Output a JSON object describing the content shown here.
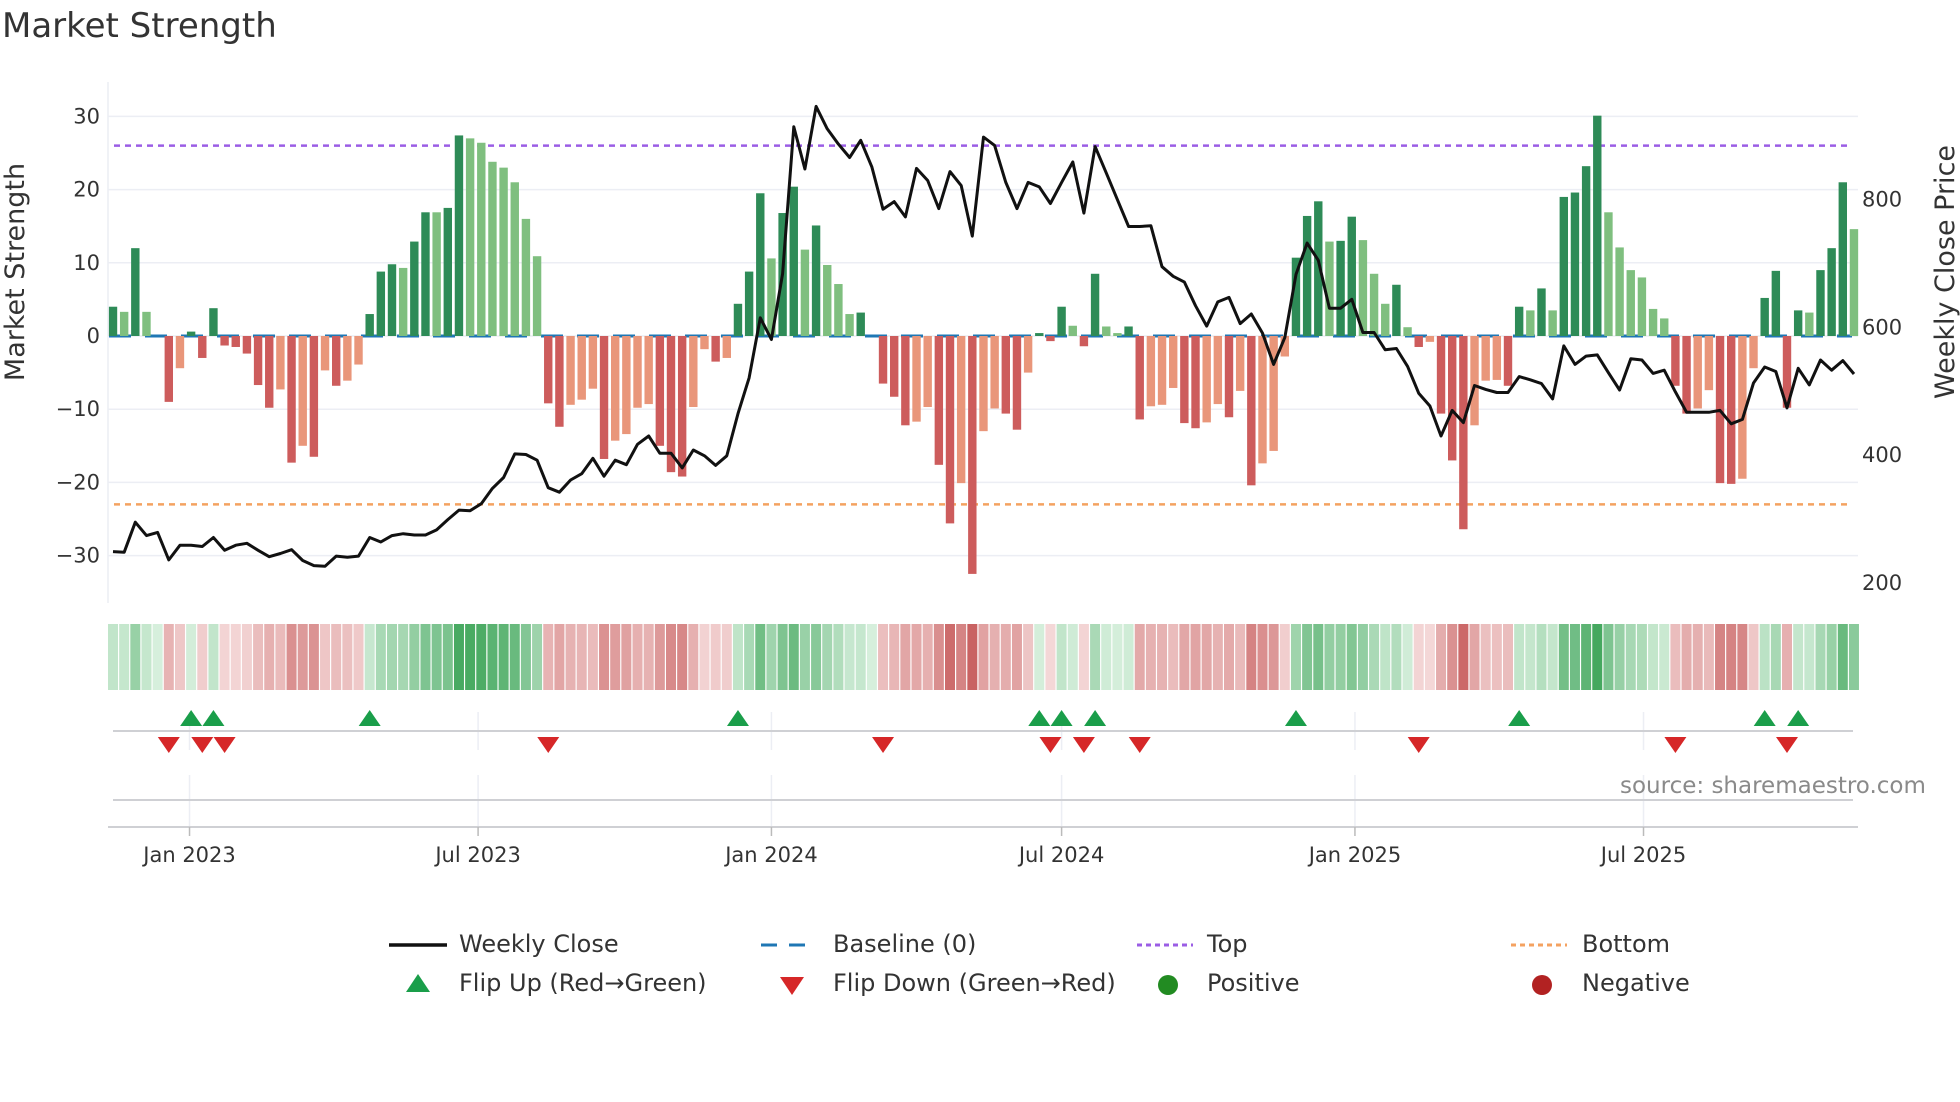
{
  "title": "Market Strength",
  "source": "source: sharemaestro.com",
  "legend": {
    "weekly_close": "Weekly Close",
    "baseline": "Baseline (0)",
    "top": "Top",
    "bottom": "Bottom",
    "flip_up": "Flip Up (Red→Green)",
    "flip_down": "Flip Down (Green→Red)",
    "positive": "Positive",
    "negative": "Negative"
  },
  "colors": {
    "rising_positive": "#2e8b57",
    "falling_positive": "#7fbf7f",
    "falling_negative": "#cd5c5c",
    "rising_negative": "#e9967a",
    "baseline": "#1f77b4",
    "top": "#9b5de5",
    "bottom": "#f4a261",
    "line": "#111111",
    "flip_up": "#1a9e4a",
    "flip_down": "#d62728",
    "positive": "#228b22",
    "negative": "#b22222"
  },
  "chart_data": {
    "type": "bar",
    "title": "Market Strength",
    "ylabel": "Market Strength",
    "y2label": "Weekly Close Price",
    "ylim": [
      -35,
      35
    ],
    "y2lim": [
      150,
      950
    ],
    "yticks": [
      "30",
      "20",
      "10",
      "0",
      "−10",
      "−20",
      "−30"
    ],
    "yticks_values": [
      30,
      20,
      10,
      0,
      -10,
      -20,
      -30
    ],
    "y2ticks": [
      "800",
      "600",
      "400",
      "200"
    ],
    "y2ticks_values": [
      800,
      600,
      400,
      200
    ],
    "xticks": [
      "Jan 2023",
      "Jul 2023",
      "Jan 2024",
      "Jul 2024",
      "Jan 2025",
      "Jul 2025"
    ],
    "xticks_dates": [
      "2023-01-01",
      "2023-07-01",
      "2024-01-01",
      "2024-07-01",
      "2025-01-01",
      "2025-07-01"
    ],
    "x_start": "2022-11-14",
    "x_step_days": 7,
    "top_level": 26,
    "bottom_level": -23,
    "baseline": 0,
    "grid": true,
    "legend_position": "bottom",
    "strength": [
      4,
      3.3,
      12,
      3.3,
      0,
      -9,
      -4.4,
      0.6,
      -3,
      3.8,
      -1.3,
      -1.5,
      -2.4,
      -6.7,
      -9.8,
      -7.3,
      -17.3,
      -15,
      -16.5,
      -4.7,
      -6.8,
      -6.1,
      -3.9,
      3,
      8.8,
      9.8,
      9.3,
      12.9,
      16.9,
      16.9,
      17.5,
      27.4,
      27,
      26.4,
      23.8,
      23,
      21,
      16,
      10.9,
      -9.2,
      -12.4,
      -9.4,
      -8.7,
      -7.2,
      -16.8,
      -14.3,
      -13.4,
      -9.8,
      -9.3,
      -15,
      -18.6,
      -19.2,
      -9.7,
      -1.8,
      -3.5,
      -3,
      4.4,
      8.8,
      19.5,
      10.6,
      16.8,
      20.4,
      11.8,
      15.1,
      9.7,
      7.1,
      3,
      3.2,
      0,
      -6.5,
      -8.3,
      -12.2,
      -11.7,
      -9.7,
      -17.6,
      -25.6,
      -20.1,
      -32.5,
      -13,
      -9.9,
      -10.6,
      -12.8,
      -5,
      0.4,
      -0.7,
      4,
      1.4,
      -1.4,
      8.5,
      1.3,
      0.4,
      1.3,
      -11.4,
      -9.6,
      -9.4,
      -7.1,
      -11.9,
      -12.6,
      -11.8,
      -9.3,
      -11.1,
      -7.5,
      -20.4,
      -17.4,
      -15.7,
      -2.8,
      10.7,
      16.4,
      18.4,
      12.9,
      13,
      16.3,
      13.1,
      8.5,
      4.4,
      7,
      1.2,
      -1.5,
      -0.8,
      -10.6,
      -17,
      -26.4,
      -12.2,
      -6.1,
      -6,
      -6.8,
      4,
      3.5,
      6.5,
      3.5,
      19,
      19.6,
      23.2,
      30.1,
      16.9,
      12.1,
      9,
      8,
      3.7,
      2.4,
      -6.8,
      -10.6,
      -9.9,
      -7.4,
      -20.1,
      -20.2,
      -19.5,
      -4.4,
      5.2,
      8.9,
      -9.8,
      3.5,
      3.2,
      9,
      12,
      21,
      14.6
    ],
    "weekly_close": [
      249,
      248,
      295,
      274,
      279,
      236,
      259,
      259,
      257,
      271,
      251,
      259,
      262,
      251,
      241,
      246,
      252,
      235,
      227,
      226,
      242,
      240,
      242,
      271,
      264,
      274,
      277,
      275,
      275,
      283,
      299,
      314,
      313,
      324,
      348,
      365,
      402,
      401,
      392,
      349,
      342,
      361,
      371,
      395,
      367,
      392,
      385,
      417,
      430,
      403,
      403,
      380,
      408,
      399,
      384,
      399,
      465,
      521,
      615,
      581,
      684,
      914,
      848,
      946,
      911,
      887,
      866,
      893,
      851,
      785,
      797,
      773,
      849,
      830,
      786,
      844,
      822,
      743,
      898,
      885,
      827,
      786,
      827,
      820,
      794,
      827,
      859,
      779,
      883,
      842,
      800,
      758,
      758,
      759,
      695,
      680,
      671,
      634,
      602,
      640,
      647,
      606,
      621,
      591,
      542,
      584,
      683,
      732,
      705,
      630,
      630,
      644,
      592,
      592,
      565,
      567,
      539,
      497,
      477,
      430,
      470,
      451,
      509,
      503,
      498,
      498,
      523,
      518,
      512,
      488,
      571,
      542,
      555,
      557,
      529,
      502,
      551,
      549,
      528,
      533,
      499,
      467,
      467,
      467,
      470,
      449,
      456,
      513,
      538,
      531,
      474,
      536,
      510,
      549,
      533,
      548,
      527
    ]
  }
}
